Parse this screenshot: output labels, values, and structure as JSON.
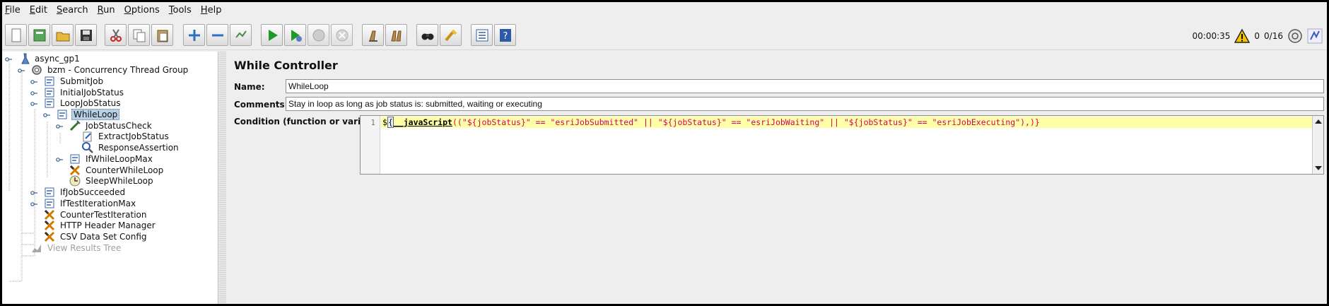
{
  "menu": [
    {
      "label": "File",
      "mnemonic": "F",
      "rest": "ile"
    },
    {
      "label": "Edit",
      "mnemonic": "E",
      "rest": "dit"
    },
    {
      "label": "Search",
      "mnemonic": "S",
      "rest": "earch"
    },
    {
      "label": "Run",
      "mnemonic": "R",
      "rest": "un"
    },
    {
      "label": "Options",
      "mnemonic": "O",
      "rest": "ptions"
    },
    {
      "label": "Tools",
      "mnemonic": "T",
      "rest": "ools"
    },
    {
      "label": "Help",
      "mnemonic": "H",
      "rest": "elp"
    }
  ],
  "toolbar": {
    "buttons": [
      "new-icon",
      "templates-icon",
      "open-icon",
      "save-icon",
      "cut-icon",
      "copy-icon",
      "paste-icon",
      "expand-icon",
      "collapse-icon",
      "toggle-icon",
      "start-icon",
      "start-no-pauses-icon",
      "stop-icon",
      "shutdown-icon",
      "clear-icon",
      "clear-all-icon",
      "search-icon",
      "reset-search-icon",
      "function-helper-icon",
      "help-icon"
    ]
  },
  "status": {
    "elapsed": "00:00:35",
    "warnings": "0",
    "threads": "0/16"
  },
  "tree": {
    "nodes": [
      {
        "label": "async_gp1",
        "icon": "test-plan-icon"
      },
      {
        "label": "bzm - Concurrency Thread Group",
        "icon": "thread-group-icon"
      },
      {
        "label": "SubmitJob",
        "icon": "controller-icon"
      },
      {
        "label": "InitialJobStatus",
        "icon": "controller-icon"
      },
      {
        "label": "LoopJobStatus",
        "icon": "controller-icon"
      },
      {
        "label": "WhileLoop",
        "icon": "controller-icon"
      },
      {
        "label": "JobStatusCheck",
        "icon": "sampler-icon"
      },
      {
        "label": "ExtractJobStatus",
        "icon": "extractor-icon"
      },
      {
        "label": "ResponseAssertion",
        "icon": "assertion-icon"
      },
      {
        "label": "IfWhileLoopMax",
        "icon": "controller-icon"
      },
      {
        "label": "CounterWhileLoop",
        "icon": "config-icon"
      },
      {
        "label": "SleepWhileLoop",
        "icon": "timer-icon"
      },
      {
        "label": "IfJobSucceeded",
        "icon": "controller-icon"
      },
      {
        "label": "IfTestIterationMax",
        "icon": "controller-icon"
      },
      {
        "label": "CounterTestIteration",
        "icon": "config-icon"
      },
      {
        "label": "HTTP Header Manager",
        "icon": "config-icon"
      },
      {
        "label": "CSV Data Set Config",
        "icon": "config-icon"
      },
      {
        "label": "View Results Tree",
        "icon": "listener-icon"
      }
    ]
  },
  "editor": {
    "title": "While Controller",
    "name_label": "Name:",
    "name_value": "WhileLoop",
    "comments_label": "Comments:",
    "comments_value": "Stay in loop as long as job status is: submitted, waiting or executing",
    "condition_label": "Condition (function or variable)",
    "line_number": "1",
    "code": {
      "prefix": "$",
      "brace": "{",
      "func": "__javaScript",
      "open": "(",
      "expr": "(\"${jobStatus}\" == \"esriJobSubmitted\" || \"${jobStatus}\" == \"esriJobWaiting\" || \"${jobStatus}\" == \"esriJobExecuting\"),)}"
    }
  },
  "colors": {
    "selection": "#b8cfe5",
    "code_highlight": "#ffffa8",
    "string": "#d2006e"
  }
}
